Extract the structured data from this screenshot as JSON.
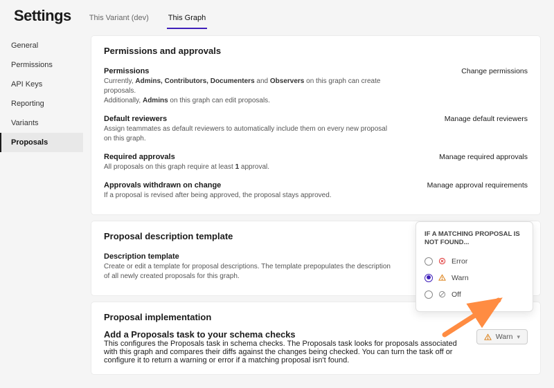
{
  "header": {
    "title": "Settings"
  },
  "tabs": [
    {
      "label": "This Variant (dev)"
    },
    {
      "label": "This Graph"
    }
  ],
  "sidebar": {
    "items": [
      {
        "label": "General"
      },
      {
        "label": "Permissions"
      },
      {
        "label": "API Keys"
      },
      {
        "label": "Reporting"
      },
      {
        "label": "Variants"
      },
      {
        "label": "Proposals"
      }
    ]
  },
  "cards": {
    "permApprovals": {
      "title": "Permissions and approvals",
      "permissions": {
        "heading": "Permissions",
        "line1_pre": "Currently, ",
        "line1_roles": "Admins, Contributors, Documenters",
        "line1_mid": " and ",
        "line1_obs": "Observers",
        "line1_post": " on this graph can create proposals.",
        "line2_pre": "Additionally, ",
        "line2_role": "Admins",
        "line2_post": " on this graph can edit proposals.",
        "action": "Change permissions"
      },
      "defaultReviewers": {
        "heading": "Default reviewers",
        "desc": "Assign teammates as default reviewers to automatically include them on every new proposal on this graph.",
        "action": "Manage default reviewers"
      },
      "requiredApprovals": {
        "heading": "Required approvals",
        "desc_pre": "All proposals on this graph require at least ",
        "desc_num": "1",
        "desc_post": " approval.",
        "action": "Manage required approvals"
      },
      "withdrawn": {
        "heading": "Approvals withdrawn on change",
        "desc": "If a proposal is revised after being approved, the proposal stays approved.",
        "action": "Manage approval requirements"
      }
    },
    "template": {
      "title": "Proposal description template",
      "heading": "Description template",
      "desc": "Create or edit a template for proposal descriptions. The template prepopulates the description of all newly created proposals for this graph."
    },
    "impl": {
      "title": "Proposal implementation",
      "heading": "Add a Proposals task to your schema checks",
      "desc": "This configures the Proposals task in schema checks. The Proposals task looks for proposals associated with this graph and compares their diffs against the changes being checked. You can turn the task off or configure it to return a warning or error if a matching proposal isn't found.",
      "button": "Warn"
    }
  },
  "popover": {
    "title": "IF A MATCHING PROPOSAL IS NOT FOUND...",
    "options": {
      "error": "Error",
      "warn": "Warn",
      "off": "Off"
    }
  }
}
